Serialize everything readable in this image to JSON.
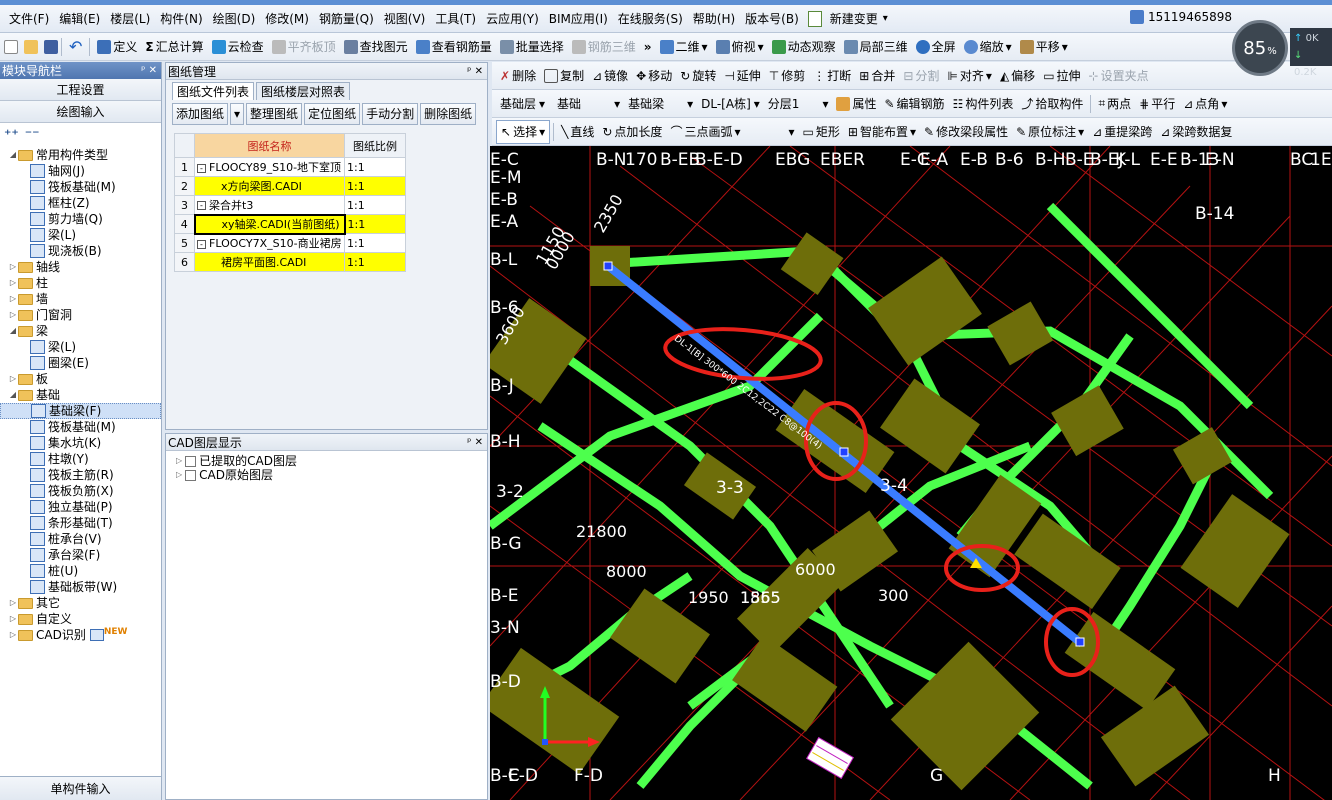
{
  "menu": [
    "文件(F)",
    "编辑(E)",
    "楼层(L)",
    "构件(N)",
    "绘图(D)",
    "修改(M)",
    "钢筋量(Q)",
    "视图(V)",
    "工具(T)",
    "云应用(Y)",
    "BIM应用(I)",
    "在线服务(S)",
    "帮助(H)",
    "版本号(B)"
  ],
  "menu_extra": "新建变更",
  "user_id": "15119465898",
  "gauge": {
    "value": "85",
    "unit": "%"
  },
  "net": {
    "up": "0K",
    "down": "0.2K"
  },
  "toolbar1": {
    "define": "定义",
    "sum": "汇总计算",
    "cloud_check": "云检查",
    "flat_top": "平齐板顶",
    "find": "查找图元",
    "view_rebar": "查看钢筋量",
    "batch": "批量选择",
    "rebar3d": "钢筋三维",
    "view2d": "二维",
    "top_view": "俯视",
    "dynamic": "动态观察",
    "local3d": "局部三维",
    "fullscreen": "全屏",
    "zoom": "缩放",
    "pan": "平移"
  },
  "nav": {
    "title": "模块导航栏",
    "btn_project": "工程设置",
    "btn_draw": "绘图输入",
    "footer": "单构件输入",
    "tree": [
      {
        "d": 0,
        "t": "常用构件类型",
        "e": "-",
        "f": true
      },
      {
        "d": 1,
        "t": "轴网(J)"
      },
      {
        "d": 1,
        "t": "筏板基础(M)"
      },
      {
        "d": 1,
        "t": "框柱(Z)"
      },
      {
        "d": 1,
        "t": "剪力墙(Q)"
      },
      {
        "d": 1,
        "t": "梁(L)"
      },
      {
        "d": 1,
        "t": "现浇板(B)"
      },
      {
        "d": 0,
        "t": "轴线",
        "e": "+",
        "f": true
      },
      {
        "d": 0,
        "t": "柱",
        "e": "+",
        "f": true
      },
      {
        "d": 0,
        "t": "墙",
        "e": "+",
        "f": true
      },
      {
        "d": 0,
        "t": "门窗洞",
        "e": "+",
        "f": true
      },
      {
        "d": 0,
        "t": "梁",
        "e": "-",
        "f": true
      },
      {
        "d": 1,
        "t": "梁(L)"
      },
      {
        "d": 1,
        "t": "圈梁(E)"
      },
      {
        "d": 0,
        "t": "板",
        "e": "+",
        "f": true
      },
      {
        "d": 0,
        "t": "基础",
        "e": "-",
        "f": true
      },
      {
        "d": 1,
        "t": "基础梁(F)",
        "sel": true
      },
      {
        "d": 1,
        "t": "筏板基础(M)"
      },
      {
        "d": 1,
        "t": "集水坑(K)"
      },
      {
        "d": 1,
        "t": "柱墩(Y)"
      },
      {
        "d": 1,
        "t": "筏板主筋(R)"
      },
      {
        "d": 1,
        "t": "筏板负筋(X)"
      },
      {
        "d": 1,
        "t": "独立基础(P)"
      },
      {
        "d": 1,
        "t": "条形基础(T)"
      },
      {
        "d": 1,
        "t": "桩承台(V)"
      },
      {
        "d": 1,
        "t": "承台梁(F)"
      },
      {
        "d": 1,
        "t": "桩(U)"
      },
      {
        "d": 1,
        "t": "基础板带(W)"
      },
      {
        "d": 0,
        "t": "其它",
        "e": "+",
        "f": true
      },
      {
        "d": 0,
        "t": "自定义",
        "e": "+",
        "f": true
      },
      {
        "d": 0,
        "t": "CAD识别",
        "e": "+",
        "f": true,
        "new": "NEW"
      }
    ]
  },
  "drawing_mgmt": {
    "title": "图纸管理",
    "tabs": [
      "图纸文件列表",
      "图纸楼层对照表"
    ],
    "buttons": [
      "添加图纸",
      "整理图纸",
      "定位图纸",
      "手动分割",
      "删除图纸"
    ],
    "headers": [
      "图纸名称",
      "图纸比例"
    ],
    "rows": [
      {
        "n": "1",
        "name": "FLOOCY89_S10-地下室顶",
        "scale": "1:1",
        "box": "-"
      },
      {
        "n": "2",
        "name": "x方向梁图.CADI",
        "scale": "1:1",
        "yl": true
      },
      {
        "n": "3",
        "name": "梁合并t3",
        "scale": "1:1",
        "box": "-"
      },
      {
        "n": "4",
        "name": "xy轴梁.CADI(当前图纸)",
        "scale": "1:1",
        "yl": true,
        "cur": true
      },
      {
        "n": "5",
        "name": "FLOOCY7X_S10-商业裙房",
        "scale": "1:1",
        "box": "-"
      },
      {
        "n": "6",
        "name": "裙房平面图.CADI",
        "scale": "1:1",
        "yl": true
      }
    ]
  },
  "cad_layers": {
    "title": "CAD图层显示",
    "items": [
      "已提取的CAD图层",
      "CAD原始图层"
    ]
  },
  "edit_toolbar": {
    "delete": "删除",
    "copy": "复制",
    "mirror": "镜像",
    "move": "移动",
    "rotate": "旋转",
    "extend": "延伸",
    "trim": "修剪",
    "break": "打断",
    "merge": "合并",
    "split": "分割",
    "align": "对齐",
    "offset": "偏移",
    "stretch": "拉伸",
    "set_point": "设置夹点"
  },
  "prop_toolbar": {
    "layer": "基础层",
    "cat": "基础",
    "type": "基础梁",
    "name": "DL-[A栋]",
    "sub": "分层1",
    "attr": "属性",
    "edit_rebar": "编辑钢筋",
    "list": "构件列表",
    "pick": "拾取构件",
    "two_pt": "两点",
    "parallel": "平行",
    "corner": "点角"
  },
  "draw_toolbar": {
    "select": "选择",
    "line": "直线",
    "pt_len": "点加长度",
    "arc3": "三点画弧",
    "rect": "矩形",
    "smart": "智能布置",
    "modify_seg": "修改梁段属性",
    "orig_mark": "原位标注",
    "re_span": "重提梁跨",
    "span_data": "梁跨数据复"
  },
  "canvas": {
    "axis_top": [
      "E-C",
      "B-N",
      "170",
      "B-EB",
      "B-E-D",
      "EBG",
      "EBER",
      "E-C",
      "E-A",
      "E-B",
      "B-6",
      "B-H",
      "B-E",
      "B-EJ",
      "K-L",
      "E-E",
      "B-13",
      "E-N",
      "BC",
      "1E"
    ],
    "axis_left": [
      "E-M",
      "E-B",
      "E-A",
      "B-L",
      "B-6",
      "B-J",
      "B-H",
      "3-2",
      "B-G",
      "B-E",
      "3-N",
      "B-D",
      "B-C",
      "E-D",
      "F-D"
    ],
    "labels": [
      "B-14",
      "3-3",
      "3-4",
      "G",
      "H",
      "2350",
      "1150",
      "0000",
      "3600"
    ],
    "dims": [
      "21800",
      "8000",
      "6000",
      "1950",
      "1865",
      "1555",
      "300"
    ],
    "beam_label": "DL-1[B]  300*600  2C12,2C22  C8@100(4)"
  }
}
